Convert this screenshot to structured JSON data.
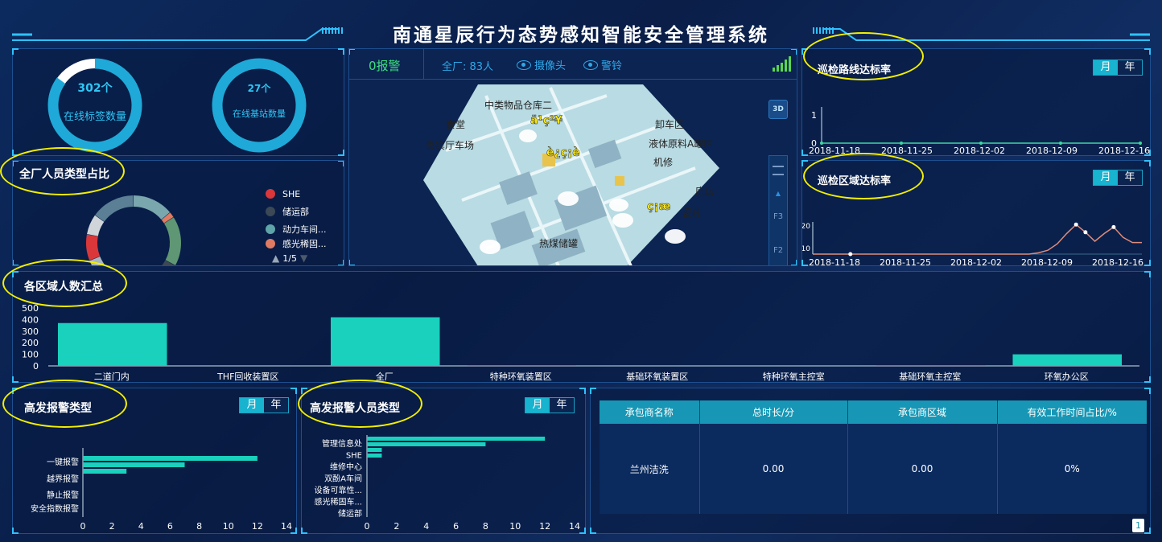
{
  "header": {
    "title": "南通星辰行为态势感知智能安全管理系统"
  },
  "online": [
    {
      "count": "302个",
      "label": "在线标签数量",
      "fraction": 0.85
    },
    {
      "count": "27个",
      "label": "在线基站数量",
      "fraction": 1.0
    }
  ],
  "personnel": {
    "title": "全厂人员类型占比",
    "legend": [
      {
        "label": "SHE",
        "color": "#d9373a"
      },
      {
        "label": "储运部",
        "color": "#3b4855"
      },
      {
        "label": "动力车间...",
        "color": "#5fa4a8"
      },
      {
        "label": "感光稀固...",
        "color": "#e07b63"
      }
    ],
    "pager": "1/5",
    "segments": [
      {
        "color": "#7aa6ad",
        "value": 14
      },
      {
        "color": "#e07b63",
        "value": 2
      },
      {
        "color": "#5f9674",
        "value": 17
      },
      {
        "color": "#3b4855",
        "value": 16
      },
      {
        "color": "#a9b6c2",
        "value": 20
      },
      {
        "color": "#d9373a",
        "value": 9
      },
      {
        "color": "#cfd5d9",
        "value": 7
      },
      {
        "color": "#5b7f94",
        "value": 15
      }
    ]
  },
  "map": {
    "alarm": "0报警",
    "total": "全厂: 83人",
    "camera": "摄像头",
    "bell": "警铃",
    "btn_3d": "3D",
    "floor_f3": "F3",
    "floor_f2": "F2",
    "labels": [
      "中类物品仓库二",
      "食堂",
      "贵宾厅车场",
      "卸车区",
      "液体原料A罐区",
      "机修",
      "库房",
      "品库",
      "热煤储罐"
    ]
  },
  "patrol_route": {
    "title": "巡检路线达标率",
    "toggle": [
      "月",
      "年"
    ],
    "chart_data": {
      "type": "line",
      "x": [
        "2018-11-18",
        "2018-11-25",
        "2018-12-02",
        "2018-12-09",
        "2018-12-16"
      ],
      "yticks": [
        "0",
        "1"
      ],
      "values": [
        0,
        0,
        0,
        0,
        0
      ]
    }
  },
  "patrol_area": {
    "title": "巡检区域达标率",
    "toggle": [
      "月",
      "年"
    ],
    "chart_data": {
      "type": "line",
      "x": [
        "2018-11-18",
        "2018-11-25",
        "2018-12-02",
        "2018-12-09",
        "2018-12-16"
      ],
      "yticks": [
        "20",
        "10"
      ],
      "values": [
        0,
        0,
        0,
        0,
        0,
        0,
        0,
        0,
        0,
        0,
        0,
        0,
        0,
        0,
        0,
        0,
        0,
        0,
        0,
        0,
        0,
        0,
        0,
        0,
        1,
        3,
        8,
        16,
        23,
        17,
        10,
        16,
        21,
        13,
        9,
        9
      ]
    }
  },
  "region_count": {
    "title": "各区域人数汇总",
    "chart_data": {
      "type": "bar",
      "categories": [
        "二道门内",
        "THF回收装置区",
        "全厂",
        "特种环氧装置区",
        "基础环氧装置区",
        "特种环氧主控室",
        "基础环氧主控室",
        "环氧办公区"
      ],
      "values": [
        370,
        0,
        420,
        5,
        0,
        0,
        5,
        100
      ],
      "ylim": [
        0,
        500
      ],
      "yticks": [
        "500",
        "400",
        "300",
        "200",
        "100",
        "0"
      ]
    }
  },
  "alarm_type": {
    "title": "高发报警类型",
    "toggle": [
      "月",
      "年"
    ],
    "chart_data": {
      "type": "bar",
      "categories": [
        "一键报警",
        "越界报警",
        "静止报警",
        "安全指数报警"
      ],
      "series": [
        {
          "values": [
            12,
            7,
            3,
            0
          ]
        }
      ],
      "xticks": [
        "0",
        "2",
        "4",
        "6",
        "8",
        "10",
        "12",
        "14"
      ],
      "xlim": [
        0,
        14
      ]
    }
  },
  "alarm_people": {
    "title": "高发报警人员类型",
    "toggle": [
      "月",
      "年"
    ],
    "chart_data": {
      "type": "bar",
      "categories": [
        "管理信息处",
        "SHE",
        "维修中心",
        "双酚A车间",
        "设备可靠性...",
        "感光稀固车...",
        "储运部"
      ],
      "values": [
        12,
        1,
        0,
        0,
        0,
        0,
        0
      ],
      "extra_bar": 8,
      "xticks": [
        "0",
        "2",
        "4",
        "6",
        "8",
        "10",
        "12",
        "14"
      ],
      "xlim": [
        0,
        14
      ]
    }
  },
  "contractor": {
    "headers": [
      "承包商名称",
      "总时长/分",
      "承包商区域",
      "有效工作时间占比/%"
    ],
    "rows": [
      [
        "兰州洁洗",
        "0.00",
        "0.00",
        "0%"
      ]
    ],
    "page": "1"
  }
}
